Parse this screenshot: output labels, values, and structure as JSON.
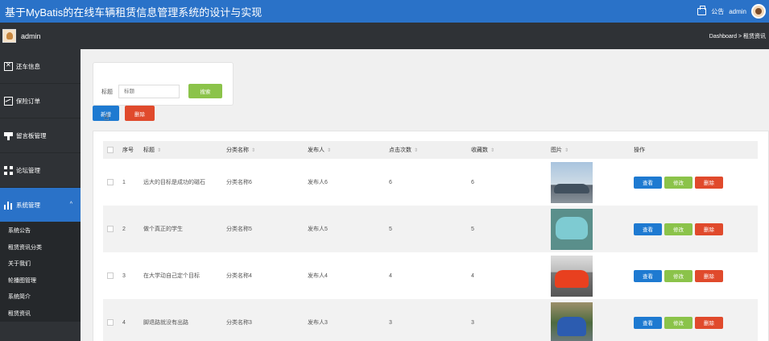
{
  "header": {
    "title": "基于MyBatis的在线车辆租赁信息管理系统的设计与实现",
    "announcement_label": "公告",
    "user": "admin"
  },
  "subbar": {
    "user": "admin",
    "breadcrumb": "Dashboard > 租赁资讯"
  },
  "sidebar": {
    "items": [
      {
        "label": "还车信息",
        "icon": "car-icon"
      },
      {
        "label": "保险订单",
        "icon": "chart-icon"
      },
      {
        "label": "留言板管理",
        "icon": "board-icon"
      },
      {
        "label": "论坛管理",
        "icon": "grid-icon"
      },
      {
        "label": "系统管理",
        "icon": "bars-icon"
      }
    ],
    "expand_glyph": "^",
    "submenu": [
      "系统公告",
      "租赁资讯分类",
      "关于我们",
      "轮播图管理",
      "系统简介",
      "租赁资讯"
    ]
  },
  "search": {
    "label": "标题",
    "placeholder": "标题",
    "button": "搜索"
  },
  "toolbar": {
    "add": "新增",
    "delete": "删除"
  },
  "table": {
    "headers": [
      "序号",
      "标题",
      "分类名称",
      "发布人",
      "点击次数",
      "收藏数",
      "图片",
      "操作"
    ],
    "sort_glyph": "⇕",
    "rows": [
      {
        "index": "1",
        "title": "远大的目标是成功的磁石",
        "category": "分类名称6",
        "publisher": "发布人6",
        "clicks": "6",
        "favorites": "6"
      },
      {
        "index": "2",
        "title": "做个真正的学生",
        "category": "分类名称5",
        "publisher": "发布人5",
        "clicks": "5",
        "favorites": "5"
      },
      {
        "index": "3",
        "title": "在大学动自己定个目标",
        "category": "分类名称4",
        "publisher": "发布人4",
        "clicks": "4",
        "favorites": "4"
      },
      {
        "index": "4",
        "title": "脚退路就没有出路",
        "category": "分类名称3",
        "publisher": "发布人3",
        "clicks": "3",
        "favorites": "3"
      }
    ],
    "actions": {
      "view": "查看",
      "edit": "修改",
      "delete": "删除"
    }
  },
  "colors": {
    "topbar": "#2a72c8",
    "sidebar": "#2f3236",
    "primary_button": "#1e7ad1",
    "success_button": "#8bc34a",
    "danger_button": "#e04a2c"
  }
}
